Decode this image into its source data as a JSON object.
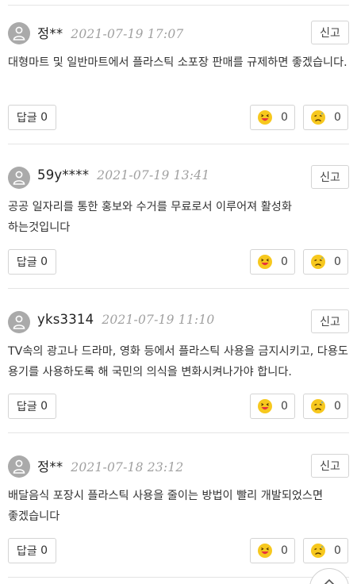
{
  "labels": {
    "report": "신고",
    "reply": "답글"
  },
  "comments": [
    {
      "author": "정**",
      "date": "2021-07-19 17:07",
      "text": "대형마트 및 일반마트에서 플라스틱 소포장 판매를 규제하면 좋겠습니다.",
      "reply_count": "0",
      "like_count": "0",
      "dislike_count": "0"
    },
    {
      "author": "59y****",
      "date": "2021-07-19 13:41",
      "text": "공공 일자리를 통한 홍보와 수거를 무료로서 이루어져 활성화 하는것입니다",
      "reply_count": "0",
      "like_count": "0",
      "dislike_count": "0"
    },
    {
      "author": "yks3314",
      "date": "2021-07-19 11:10",
      "text": "TV속의 광고나 드라마, 영화 등에서 플라스틱 사용을 금지시키고, 다용도 용기를 사용하도록 해 국민의 의식을 변화시켜나가야 합니다.",
      "reply_count": "0",
      "like_count": "0",
      "dislike_count": "0"
    },
    {
      "author": "정**",
      "date": "2021-07-18 23:12",
      "text": "배달음식 포장시 플라스틱 사용을 줄이는 방법이 빨리 개발되었스면 좋겠습니다",
      "reply_count": "0",
      "like_count": "0",
      "dislike_count": "0"
    }
  ],
  "icons": {
    "avatar": "user-icon",
    "like": "laughing-emoji-icon",
    "dislike": "sad-emoji-icon",
    "scroll_top": "chevron-up-icon"
  },
  "colors": {
    "avatar_bg": "#aaaaaa",
    "like_face": "#f7c81e",
    "like_tongue": "#e8333d",
    "border": "#d4d4d4"
  }
}
